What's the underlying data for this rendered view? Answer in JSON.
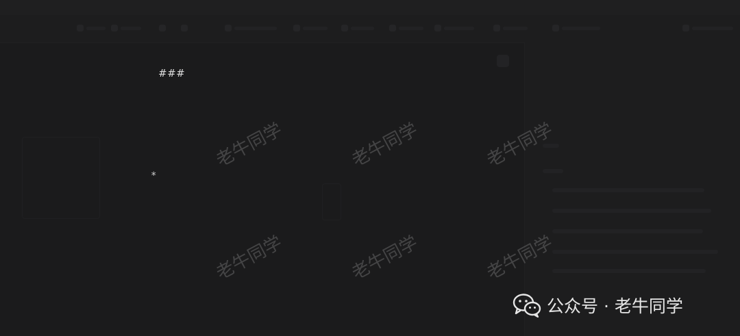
{
  "editor": {
    "heading_marker": "###",
    "bullet_marker": "*"
  },
  "watermark": {
    "text": "老牛同学"
  },
  "credit": {
    "icon": "wechat-icon",
    "text": "公众号 · 老牛同学"
  },
  "colors": {
    "background": "#1b1b1c",
    "overlay_text": "#e6e6e6",
    "watermark": "#787878"
  }
}
